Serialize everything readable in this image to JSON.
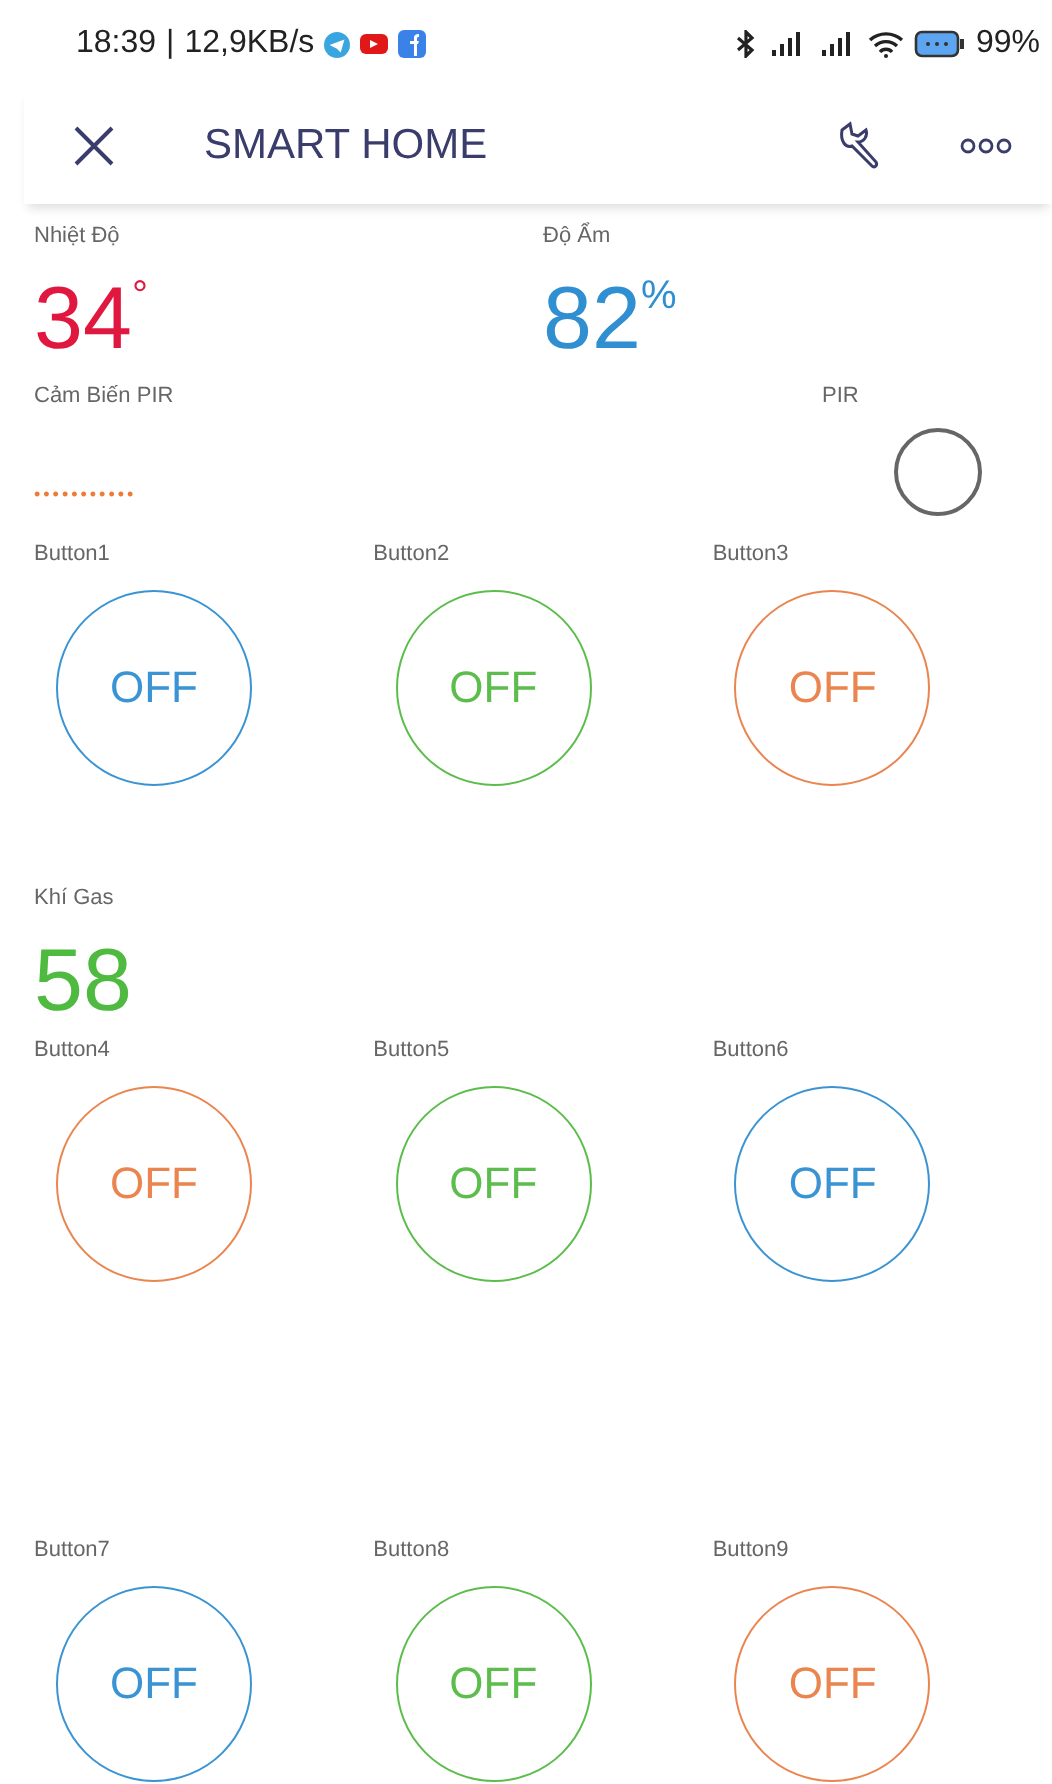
{
  "status_bar": {
    "time": "18:39",
    "separator": "|",
    "speed": "12,9KB/s",
    "battery": "99%"
  },
  "header": {
    "title": "SMART HOME"
  },
  "rows": [
    {
      "kind": "values",
      "widgets": [
        {
          "label": "Nhiệt Độ",
          "value": "34",
          "unit": "°",
          "color": "#e0173f"
        },
        {
          "label": "Độ Ẩm",
          "value": "82",
          "unit": "%",
          "color": "#2f8fd0"
        }
      ]
    },
    {
      "kind": "pir",
      "label": "Cảm Biến PIR",
      "dots": "•••••••••••",
      "indicator_label": "PIR",
      "on": false
    },
    {
      "kind": "buttons",
      "widgets": [
        {
          "label": "Button1",
          "state": "OFF",
          "color": "#3a94d4"
        },
        {
          "label": "Button2",
          "state": "OFF",
          "color": "#5cbd4c"
        },
        {
          "label": "Button3",
          "state": "OFF",
          "color": "#ea8550"
        }
      ]
    },
    {
      "kind": "values",
      "widgets": [
        {
          "label": "Khí Gas",
          "value": "58",
          "color": "#4fba40"
        }
      ]
    },
    {
      "kind": "buttons",
      "widgets": [
        {
          "label": "Button4",
          "state": "OFF",
          "color": "#ea8550"
        },
        {
          "label": "Button5",
          "state": "OFF",
          "color": "#5cbd4c"
        },
        {
          "label": "Button6",
          "state": "OFF",
          "color": "#3a94d4"
        }
      ]
    },
    {
      "kind": "gap"
    },
    {
      "kind": "buttons",
      "widgets": [
        {
          "label": "Button7",
          "state": "OFF",
          "color": "#3a94d4"
        },
        {
          "label": "Button8",
          "state": "OFF",
          "color": "#5cbd4c"
        },
        {
          "label": "Button9",
          "state": "OFF",
          "color": "#ea8550"
        }
      ]
    }
  ]
}
